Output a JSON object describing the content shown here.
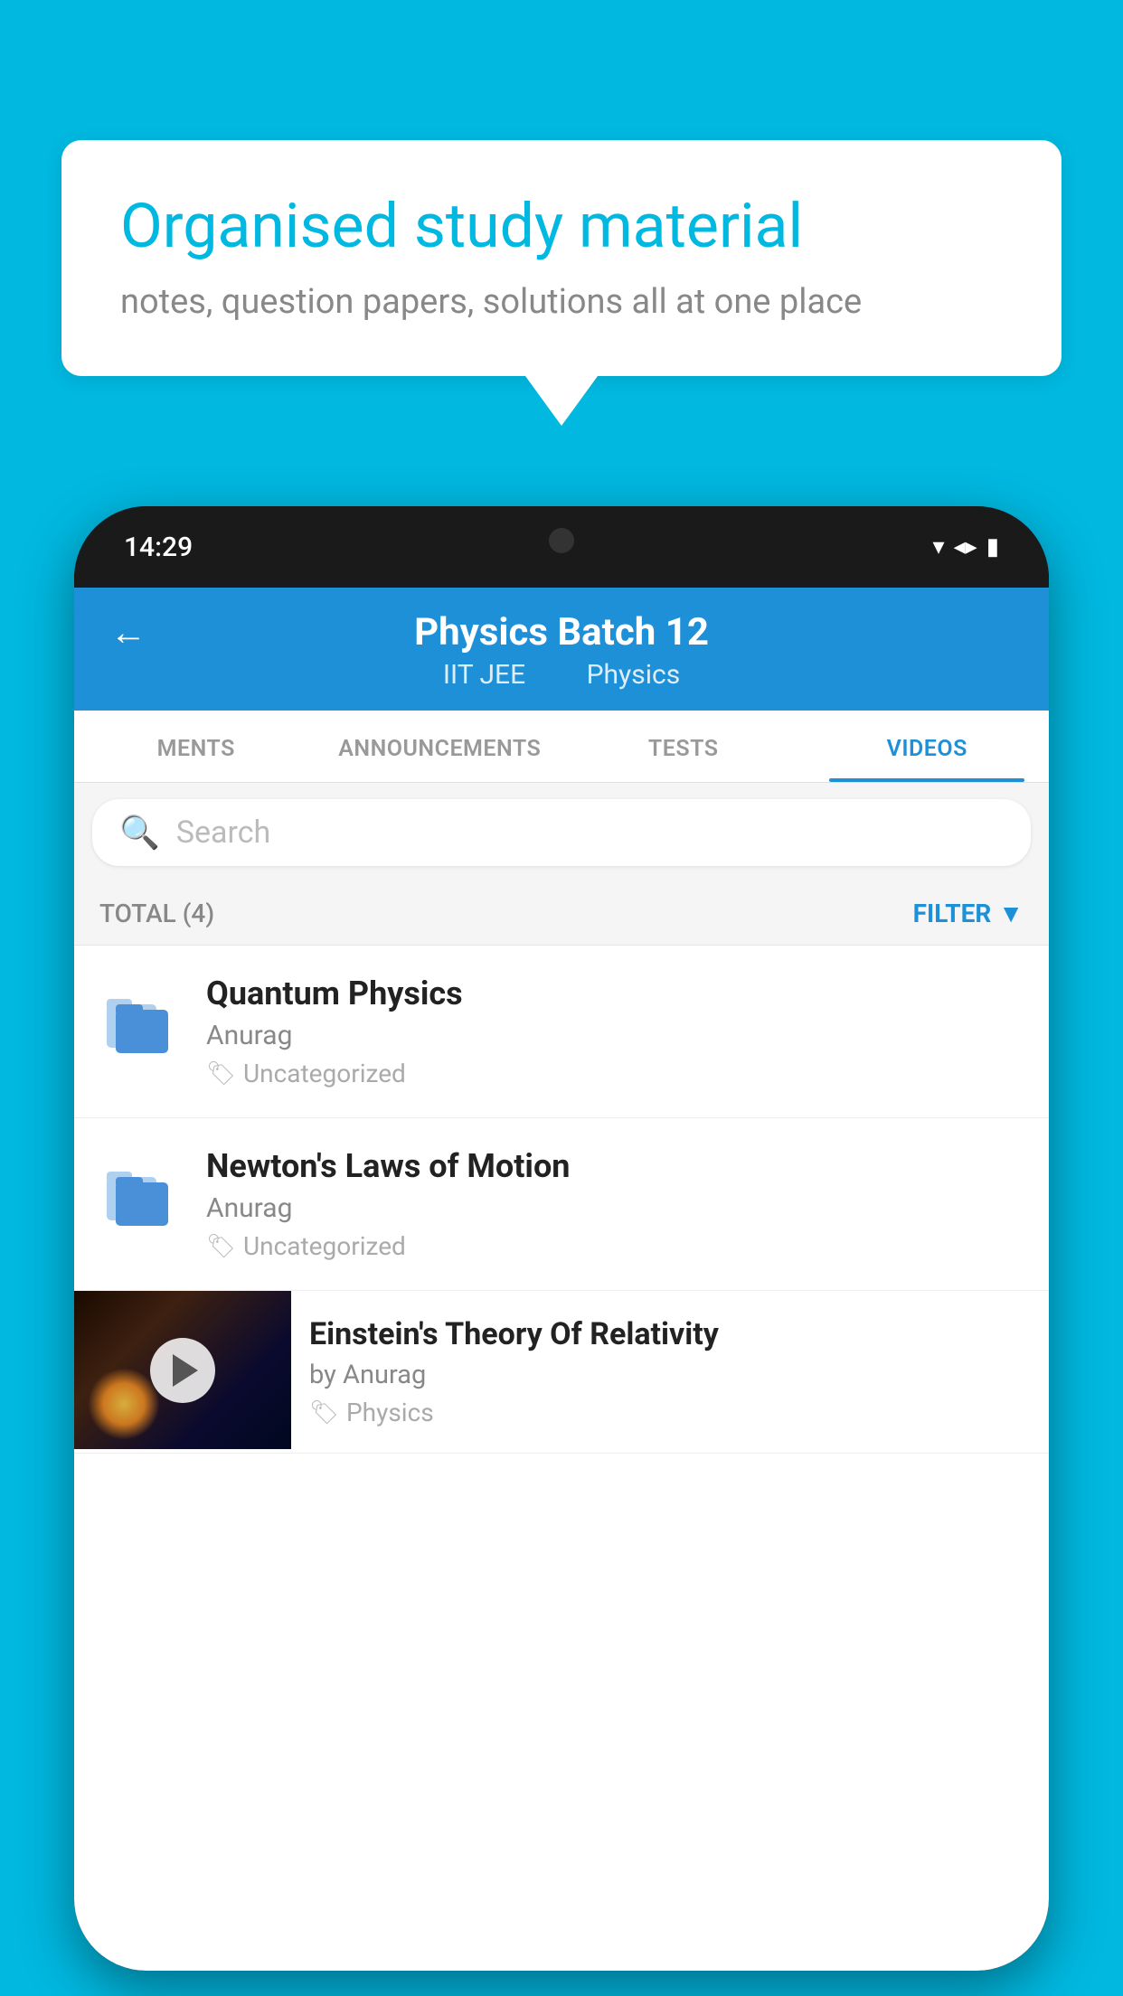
{
  "background_color": "#00B8E0",
  "speech_bubble": {
    "title": "Organised study material",
    "subtitle": "notes, question papers, solutions all at one place"
  },
  "phone": {
    "status_bar": {
      "time": "14:29",
      "icons": [
        "wifi",
        "signal",
        "battery"
      ]
    },
    "header": {
      "back_label": "←",
      "title": "Physics Batch 12",
      "subtitle_parts": [
        "IIT JEE",
        "Physics"
      ]
    },
    "tabs": [
      {
        "label": "MENTS",
        "active": false
      },
      {
        "label": "ANNOUNCEMENTS",
        "active": false
      },
      {
        "label": "TESTS",
        "active": false
      },
      {
        "label": "VIDEOS",
        "active": true
      }
    ],
    "search": {
      "placeholder": "Search"
    },
    "filter_bar": {
      "total_label": "TOTAL (4)",
      "filter_label": "FILTER"
    },
    "videos": [
      {
        "title": "Quantum Physics",
        "author": "Anurag",
        "tag": "Uncategorized",
        "has_thumb": false
      },
      {
        "title": "Newton's Laws of Motion",
        "author": "Anurag",
        "tag": "Uncategorized",
        "has_thumb": false
      },
      {
        "title": "Einstein's Theory Of Relativity",
        "author": "by Anurag",
        "tag": "Physics",
        "has_thumb": true
      }
    ]
  }
}
